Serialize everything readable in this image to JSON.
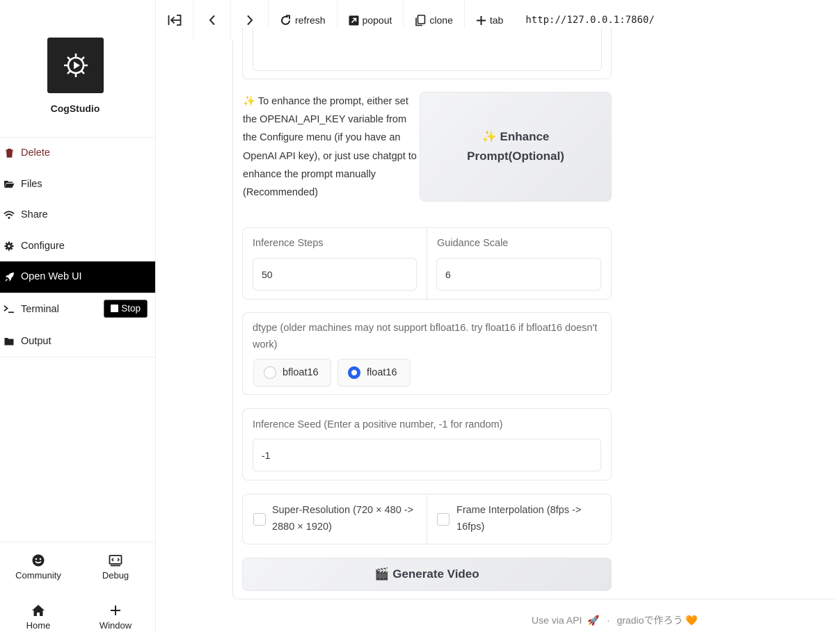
{
  "app": {
    "name": "CogStudio"
  },
  "sidebar": {
    "items": [
      {
        "label": "Delete",
        "icon": "trash-icon"
      },
      {
        "label": "Files",
        "icon": "folder-open-icon"
      },
      {
        "label": "Share",
        "icon": "wifi-icon"
      },
      {
        "label": "Configure",
        "icon": "gear-icon"
      },
      {
        "label": "Open Web UI",
        "icon": "rocket-icon"
      },
      {
        "label": "Terminal",
        "icon": "terminal-icon"
      },
      {
        "label": "Output",
        "icon": "folder-icon"
      }
    ],
    "stop_label": "Stop",
    "bottom": [
      {
        "label": "Community",
        "icon": "smile-icon"
      },
      {
        "label": "Debug",
        "icon": "debug-icon"
      },
      {
        "label": "Home",
        "icon": "home-icon"
      },
      {
        "label": "Window",
        "icon": "plus-icon"
      }
    ]
  },
  "toolbar": {
    "refresh": "refresh",
    "popout": "popout",
    "clone": "clone",
    "tab": "tab",
    "url": "http://127.0.0.1:7860/"
  },
  "main": {
    "enhance_hint": "✨ To enhance the prompt, either set the OPENAI_API_KEY variable from the Configure menu (if you have an OpenAI API key), or just use chatgpt to enhance the prompt manually (Recommended)",
    "enhance_button": "✨ Enhance Prompt(Optional)",
    "inference_steps": {
      "label": "Inference Steps",
      "value": "50"
    },
    "guidance_scale": {
      "label": "Guidance Scale",
      "value": "6"
    },
    "dtype": {
      "label": "dtype (older machines may not support bfloat16. try float16 if bfloat16 doesn't work)",
      "options": [
        "bfloat16",
        "float16"
      ],
      "selected": "float16"
    },
    "seed": {
      "label": "Inference Seed (Enter a positive number, -1 for random)",
      "value": "-1"
    },
    "super_resolution": "Super-Resolution (720 × 480 -> 2880 × 1920)",
    "frame_interpolation": "Frame Interpolation (8fps -> 16fps)",
    "generate_button": "🎬 Generate Video"
  },
  "footer": {
    "api": "Use via API",
    "api_emoji": "🚀",
    "separator": "·",
    "gradio": "gradioで作ろう",
    "gradio_emoji": "🧡"
  },
  "colors": {
    "accent": "#2563eb",
    "active_bg": "#000000",
    "delete": "#7b2a2a"
  }
}
